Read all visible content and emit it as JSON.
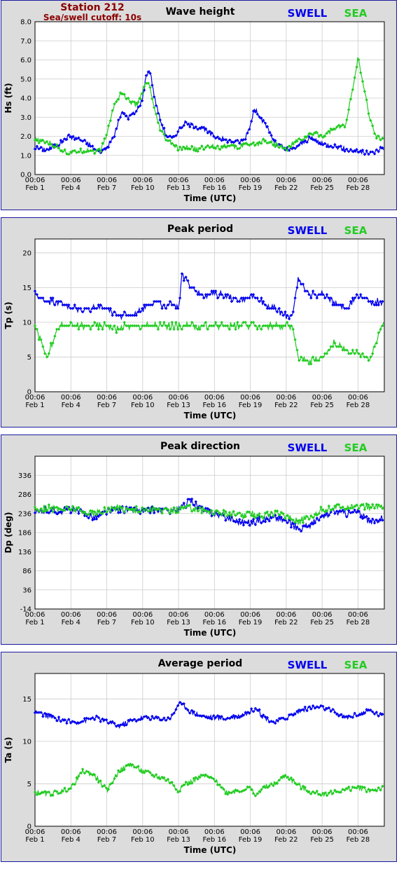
{
  "station": {
    "name": "Station 212",
    "cutoff": "Sea/swell cutoff: 10s"
  },
  "legend": {
    "swell": "SWELL",
    "sea": "SEA",
    "swell_color": "#0000ee",
    "sea_color": "#22cc22"
  },
  "time_axis": {
    "label": "Time (UTC)",
    "ticks": [
      {
        "day": 0,
        "time": "00:06",
        "date": "Feb 1"
      },
      {
        "day": 3,
        "time": "00:06",
        "date": "Feb 4"
      },
      {
        "day": 6,
        "time": "00:06",
        "date": "Feb 7"
      },
      {
        "day": 9,
        "time": "00:06",
        "date": "Feb 10"
      },
      {
        "day": 12,
        "time": "00:06",
        "date": "Feb 13"
      },
      {
        "day": 15,
        "time": "00:06",
        "date": "Feb 16"
      },
      {
        "day": 18,
        "time": "00:06",
        "date": "Feb 19"
      },
      {
        "day": 21,
        "time": "00:06",
        "date": "Feb 22"
      },
      {
        "day": 24,
        "time": "00:06",
        "date": "Feb 25"
      },
      {
        "day": 27,
        "time": "00:06",
        "date": "Feb 28"
      }
    ]
  },
  "chart_data": [
    {
      "type": "line",
      "title": "Wave height",
      "ylabel": "Hs (ft)",
      "xlabel": "Time (UTC)",
      "ylim": [
        0,
        8
      ],
      "yticks": [
        "0.0",
        "1.0",
        "2.0",
        "3.0",
        "4.0",
        "5.0",
        "6.0",
        "7.0",
        "8.0"
      ],
      "x_days": [
        0,
        1,
        2,
        2.8,
        3.5,
        4.5,
        5,
        5.5,
        6,
        6.6,
        7.2,
        7.8,
        8.5,
        9,
        9.3,
        9.6,
        10,
        10.5,
        11,
        11.5,
        12,
        12.5,
        13,
        13.5,
        14,
        15,
        15.5,
        16,
        17,
        17.5,
        18,
        18.3,
        18.7,
        19,
        19.5,
        20,
        21,
        21.5,
        22,
        22.5,
        23,
        23.5,
        24,
        25,
        26,
        27,
        28,
        28.5,
        29
      ],
      "series": [
        {
          "name": "SWELL",
          "values": [
            1.4,
            1.3,
            1.6,
            2.0,
            1.9,
            1.6,
            1.3,
            1.2,
            1.4,
            2.0,
            3.2,
            3.0,
            3.3,
            4.0,
            5.2,
            5.5,
            4.0,
            2.8,
            2.0,
            1.9,
            2.3,
            2.7,
            2.6,
            2.5,
            2.4,
            2.0,
            1.9,
            1.8,
            1.7,
            1.8,
            2.6,
            3.4,
            3.2,
            2.8,
            2.4,
            1.7,
            1.3,
            1.3,
            1.5,
            1.7,
            1.9,
            1.8,
            1.6,
            1.5,
            1.3,
            1.2,
            1.1,
            1.2,
            1.4
          ]
        },
        {
          "name": "SEA",
          "values": [
            1.8,
            1.7,
            1.4,
            1.1,
            1.2,
            1.3,
            1.2,
            1.3,
            2.1,
            3.6,
            4.3,
            3.9,
            3.6,
            4.4,
            4.8,
            4.6,
            3.3,
            2.3,
            1.8,
            1.6,
            1.3,
            1.4,
            1.4,
            1.3,
            1.4,
            1.5,
            1.4,
            1.5,
            1.4,
            1.6,
            1.5,
            1.6,
            1.6,
            1.8,
            1.7,
            1.6,
            1.3,
            1.6,
            1.8,
            1.9,
            2.1,
            2.2,
            2.0,
            2.4,
            2.6,
            6.1,
            2.9,
            2.0,
            1.9
          ]
        }
      ]
    },
    {
      "type": "line",
      "title": "Peak period",
      "ylabel": "Tp (s)",
      "xlabel": "Time (UTC)",
      "ylim": [
        0,
        22
      ],
      "yticks": [
        "0",
        "5",
        "10",
        "15",
        "20"
      ],
      "x_days": [
        0,
        1,
        2,
        3,
        4,
        5,
        6,
        7,
        7.5,
        8,
        9,
        10,
        11,
        11.5,
        12,
        12.3,
        13,
        14,
        15,
        16,
        17,
        18,
        19,
        20,
        21,
        21.5,
        22,
        23,
        24,
        25,
        26,
        27,
        28,
        29
      ],
      "series": [
        {
          "name": "SWELL",
          "values": [
            14,
            13,
            13,
            12,
            12,
            12,
            12,
            11,
            11,
            11,
            12,
            13,
            12,
            13,
            12,
            17,
            15,
            14,
            14,
            14,
            13,
            14,
            13,
            12,
            11,
            11,
            16,
            14,
            14,
            13,
            12,
            14,
            13,
            13
          ]
        },
        {
          "name": "SEA",
          "values": [
            9.5,
            5,
            9.5,
            9.5,
            9.5,
            9.5,
            9.5,
            9,
            9.5,
            9.5,
            9.5,
            9.5,
            9.5,
            9.5,
            9.5,
            9.5,
            9.5,
            9.5,
            9.5,
            9.5,
            9.5,
            9.5,
            9.5,
            9.5,
            9.5,
            9.5,
            5,
            4.5,
            5,
            7,
            6,
            5.5,
            4.5,
            9.5
          ]
        }
      ]
    },
    {
      "type": "line",
      "title": "Peak direction",
      "ylabel": "Dp (deg)",
      "xlabel": "Time (UTC)",
      "ylim": [
        -14,
        386
      ],
      "yticks": [
        "-14",
        "36",
        "86",
        "136",
        "186",
        "236",
        "286",
        "336"
      ],
      "x_days": [
        0,
        1,
        2,
        3,
        4,
        5,
        6,
        7,
        8,
        9,
        10,
        10.5,
        11,
        11.5,
        12,
        12.5,
        13,
        14,
        15,
        16,
        17,
        18,
        19,
        20,
        21,
        22,
        23,
        24,
        25,
        26,
        27,
        28,
        29
      ],
      "series": [
        {
          "name": "SWELL",
          "values": [
            236,
            246,
            241,
            246,
            236,
            226,
            241,
            246,
            246,
            241,
            246,
            246,
            241,
            246,
            246,
            256,
            271,
            246,
            236,
            226,
            216,
            211,
            221,
            226,
            216,
            196,
            206,
            226,
            241,
            236,
            241,
            211,
            226
          ]
        },
        {
          "name": "SEA",
          "values": [
            246,
            251,
            246,
            251,
            241,
            236,
            246,
            251,
            246,
            246,
            246,
            246,
            241,
            246,
            246,
            251,
            251,
            246,
            241,
            236,
            231,
            236,
            231,
            236,
            231,
            216,
            226,
            246,
            251,
            256,
            256,
            251,
            256
          ]
        }
      ]
    },
    {
      "type": "line",
      "title": "Average period",
      "ylabel": "Ta (s)",
      "xlabel": "Time (UTC)",
      "ylim": [
        0,
        18
      ],
      "yticks": [
        "0",
        "5",
        "10",
        "15"
      ],
      "x_days": [
        0,
        1,
        2,
        3,
        4,
        5,
        6,
        7,
        8,
        9,
        10,
        11,
        11.5,
        12,
        12.5,
        13,
        14,
        15,
        16,
        17,
        18,
        18.5,
        19,
        20,
        21,
        22,
        23,
        24,
        25,
        26,
        27,
        28,
        29
      ],
      "series": [
        {
          "name": "SWELL",
          "values": [
            13.5,
            13,
            12.6,
            12.3,
            12.4,
            12.8,
            12.3,
            11.8,
            12.4,
            12.8,
            12.7,
            12.6,
            13,
            14.5,
            14.2,
            13.5,
            13,
            12.8,
            12.7,
            13,
            13.5,
            14,
            13,
            12.2,
            12.8,
            13.5,
            14,
            14,
            13.5,
            12.8,
            13.2,
            13.6,
            13
          ]
        },
        {
          "name": "SEA",
          "values": [
            4,
            3.8,
            4,
            4.5,
            6.5,
            6,
            4.2,
            6.5,
            7.3,
            6.5,
            6,
            5.5,
            5,
            4.2,
            5,
            5.2,
            6,
            5.5,
            4,
            4.2,
            4.5,
            3.5,
            4.5,
            5,
            6,
            4.8,
            4,
            3.8,
            4,
            4.3,
            4.6,
            4.2,
            4.5
          ]
        }
      ]
    }
  ]
}
